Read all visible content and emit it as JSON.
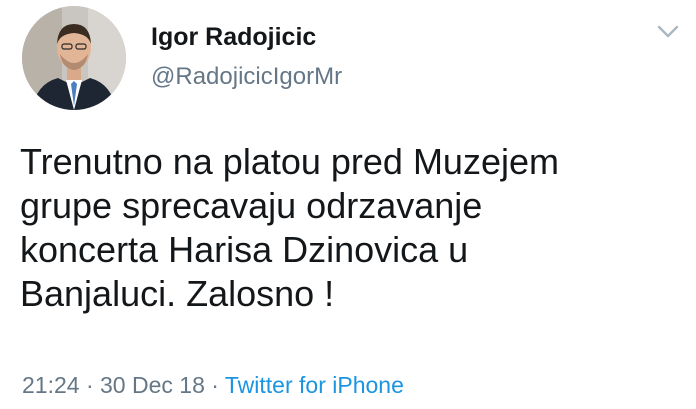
{
  "tweet": {
    "author": {
      "display_name": "Igor Radojicic",
      "handle": "@RadojicicIgorMr"
    },
    "text_lines": [
      "Trenutno na platou pred Muzejem",
      "grupe sprecavaju odrzavanje",
      "koncerta Harisa Dzinovica u",
      "Banjaluci. Zalosno !"
    ],
    "time": "21:24",
    "separator": " · ",
    "date": "30 Dec 18",
    "source": "Twitter for iPhone",
    "menu_icon": "chevron-down-icon"
  },
  "colors": {
    "text": "#14171a",
    "secondary": "#657786",
    "link": "#1b95e0"
  }
}
